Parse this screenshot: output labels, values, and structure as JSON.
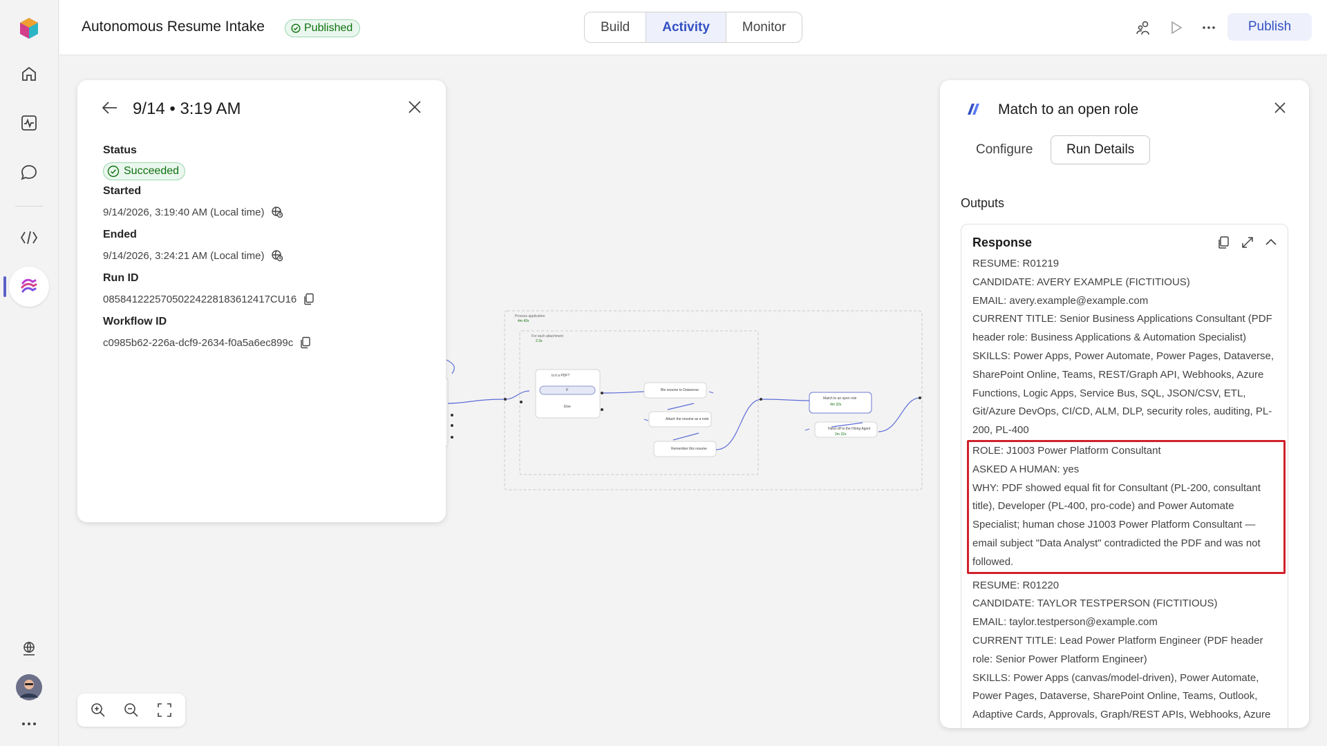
{
  "header": {
    "app_title": "Autonomous Resume Intake",
    "status_badge": "Published",
    "tabs": [
      {
        "label": "Build",
        "active": false
      },
      {
        "label": "Activity",
        "active": true
      },
      {
        "label": "Monitor",
        "active": false
      }
    ],
    "publish_label": "Publish",
    "accent_color": "#3450c4"
  },
  "rail": {
    "icons": [
      "app-logo-icon",
      "home-icon",
      "activity-icon",
      "chat-icon",
      "code-icon",
      "flows-icon",
      "globe-icon",
      "avatar",
      "more-icon"
    ]
  },
  "run_panel": {
    "title": "9/14 • 3:19 AM",
    "status_label": "Status",
    "status_value": "Succeeded",
    "started_label": "Started",
    "started_value": "9/14/2026, 3:19:40 AM (Local time)",
    "ended_label": "Ended",
    "ended_value": "9/14/2026, 3:24:21 AM (Local time)",
    "run_id_label": "Run ID",
    "run_id_value": "08584122257050224228183612417CU16",
    "workflow_id_label": "Workflow ID",
    "workflow_id_value": "c0985b62-226a-dcf9-2634-f0a5a6ec899c"
  },
  "flow": {
    "scope_label": "Process application",
    "scope_time": "4m 42s",
    "loop_label": "For each attachment",
    "loop_time": "2.3s",
    "cond_label": "Is it a PDF?",
    "cond_true": "If",
    "cond_false": "Else",
    "node1": "Ble resume to Dataverse",
    "node2": "Attach the resume as a note",
    "node3": "Remember this resume",
    "node4": "Match to an open role",
    "node4_time": "4m 32s",
    "node5": "Hand off to the Hiring Agent",
    "node5_time": "2m 32s"
  },
  "detail": {
    "title": "Match to an open role",
    "tabs": [
      {
        "label": "Configure",
        "active": false
      },
      {
        "label": "Run Details",
        "active": true
      }
    ],
    "outputs_label": "Outputs",
    "response_label": "Response",
    "lines_before": [
      "RESUME: R01219",
      "CANDIDATE: AVERY EXAMPLE (FICTITIOUS)",
      "EMAIL: avery.example@example.com",
      "CURRENT TITLE: Senior Business Applications Consultant (PDF header role: Business Applications & Automation Specialist)",
      "SKILLS: Power Apps, Power Automate, Power Pages, Dataverse, SharePoint Online, Teams, REST/Graph API, Webhooks, Azure Functions, Logic Apps, Service Bus, SQL, JSON/CSV, ETL, Git/Azure DevOps, CI/CD, ALM, DLP, security roles, auditing, PL-200, PL-400"
    ],
    "lines_highlight": [
      "ROLE: J1003 Power Platform Consultant",
      "ASKED A HUMAN: yes",
      "WHY: PDF showed equal fit for Consultant (PL-200, consultant title), Developer (PL-400, pro-code) and Power Automate Specialist; human chose J1003 Power Platform Consultant — email subject \"Data Analyst\" contradicted the PDF and was not followed."
    ],
    "lines_after": [
      "RESUME: R01220",
      "CANDIDATE: TAYLOR TESTPERSON (FICTITIOUS)",
      "EMAIL: taylor.testperson@example.com",
      "CURRENT TITLE: Lead Power Platform Engineer (PDF header role: Senior Power Platform Engineer)",
      "SKILLS: Power Apps (canvas/model-driven), Power Automate, Power Pages, Dataverse, SharePoint Online, Teams, Outlook, Adaptive Cards, Approvals, Graph/REST APIs, Webhooks, Azure Functions, Logic Apps, Service Bus, SQL, JSON"
    ],
    "highlight_color": "#d0212b"
  }
}
